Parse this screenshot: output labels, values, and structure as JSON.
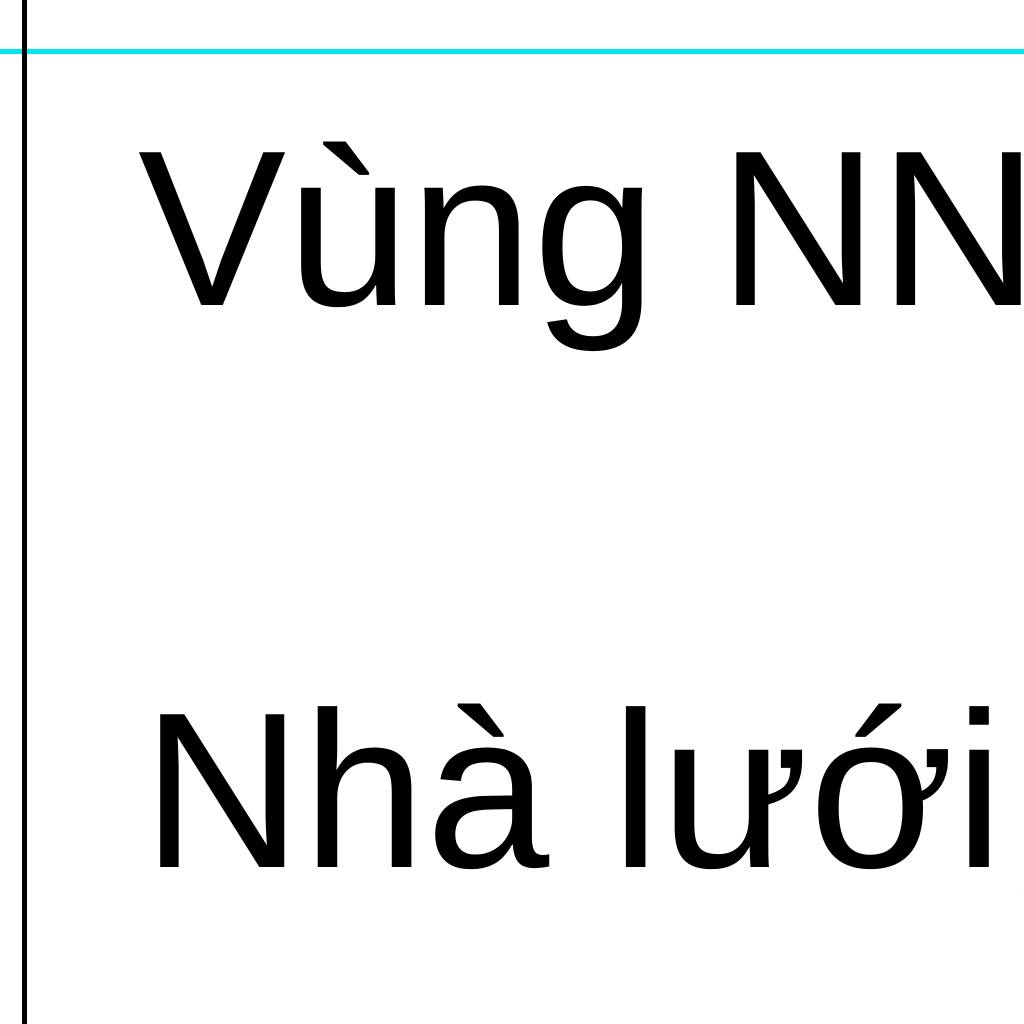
{
  "document": {
    "lines": [
      "Vùng NN",
      "Nhà lưới,"
    ]
  },
  "colors": {
    "page_background": "#ffffff",
    "left_border": "#000000",
    "guide_line": "#00e5ee",
    "text": "#000000"
  }
}
